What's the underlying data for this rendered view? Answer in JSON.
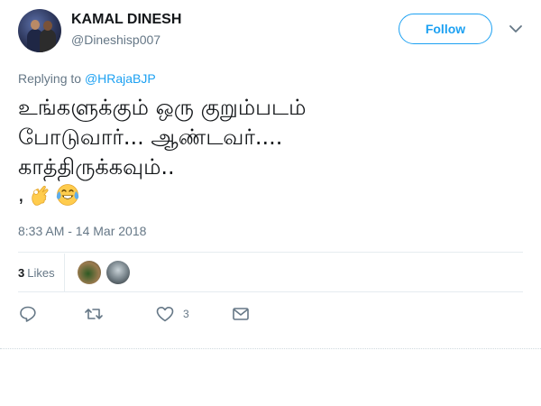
{
  "author": {
    "name": "KAMAL DINESH",
    "handle": "@Dineshisp007"
  },
  "follow_button": {
    "label": "Follow"
  },
  "reply_context": {
    "prefix": "Replying to ",
    "mention": "@HRajaBJP"
  },
  "tweet": {
    "text": "உங்களுக்கும் ஒரு குறும்படம்\nபோடுவார்... ஆண்டவர்....\nகாத்திருக்கவும்..",
    "trailing": ",",
    "emojis": [
      "ok-hand-icon",
      "tears-of-joy-icon"
    ],
    "timestamp": "8:33 AM - 14 Mar 2018"
  },
  "stats": {
    "likes_count": "3",
    "likes_label": "Likes"
  },
  "actions": {
    "like_count": "3"
  },
  "colors": {
    "accent": "#1da1f2",
    "text": "#14171a",
    "muted": "#657786",
    "divider": "#e6ecf0"
  }
}
